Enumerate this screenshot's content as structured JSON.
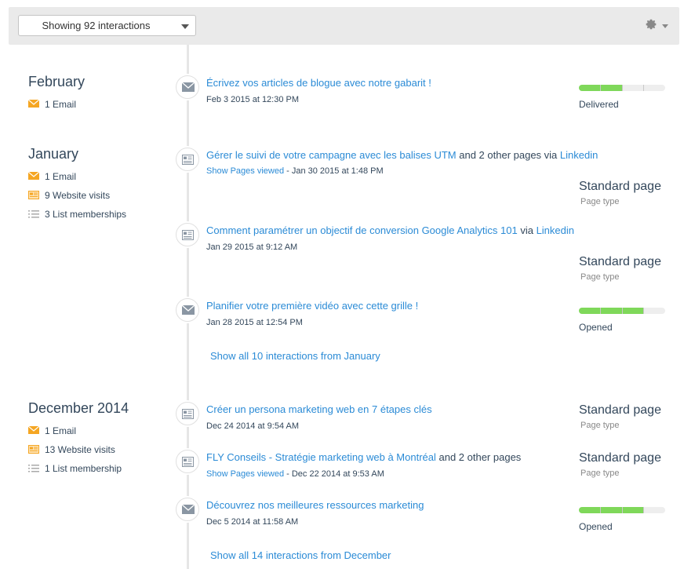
{
  "toolbar": {
    "filter_label": "Showing 92 interactions"
  },
  "months": [
    {
      "name": "February",
      "summary": [
        {
          "icon": "email-icon",
          "text": "1 Email"
        }
      ]
    },
    {
      "name": "January",
      "summary": [
        {
          "icon": "email-icon",
          "text": "1 Email"
        },
        {
          "icon": "website-visit-icon",
          "text": "9 Website visits"
        },
        {
          "icon": "list-icon",
          "text": "3 List memberships"
        }
      ],
      "show_all": "Show all 10 interactions from January"
    },
    {
      "name": "December 2014",
      "summary": [
        {
          "icon": "email-icon",
          "text": "1 Email"
        },
        {
          "icon": "website-visit-icon",
          "text": "13 Website visits"
        },
        {
          "icon": "list-icon",
          "text": "1 List membership"
        }
      ],
      "show_all": "Show all 14 interactions from December"
    }
  ],
  "interactions": [
    {
      "type": "email",
      "title": "Écrivez vos articles de blogue avec notre gabarit !",
      "date": "Feb 3 2015 at 12:30 PM",
      "status": "Delivered",
      "progress": 0.5
    },
    {
      "type": "page",
      "title": "Gérer le suivi de votre campagne avec les balises UTM",
      "extra": " and 2 other pages via ",
      "source": "Linkedin",
      "pages_link": "Show Pages viewed",
      "date": " - Jan 30 2015 at 1:48 PM",
      "meta_title": "Standard page",
      "meta_sub": "Page type"
    },
    {
      "type": "page",
      "title": "Comment paramétrer un objectif de conversion Google Analytics 101",
      "extra": " via ",
      "source": "Linkedin",
      "date": "Jan 29 2015 at 9:12 AM",
      "meta_title": "Standard page",
      "meta_sub": "Page type"
    },
    {
      "type": "email",
      "title": "Planifier votre première vidéo avec cette grille !",
      "date": "Jan 28 2015 at 12:54 PM",
      "status": "Opened",
      "progress": 0.75
    },
    {
      "type": "page",
      "title": "Créer un persona marketing web en 7 étapes clés",
      "date": "Dec 24 2014 at 9:54 AM",
      "meta_title": "Standard page",
      "meta_sub": "Page type"
    },
    {
      "type": "page",
      "title": "FLY Conseils - Stratégie marketing web à Montréal",
      "extra": " and 2 other pages",
      "pages_link": "Show Pages viewed",
      "date": " - Dec 22 2014 at 9:53 AM",
      "meta_title": "Standard page",
      "meta_sub": "Page type"
    },
    {
      "type": "email",
      "title": "Découvrez nos meilleures ressources marketing",
      "date": "Dec 5 2014 at 11:58 AM",
      "status": "Opened",
      "progress": 0.75
    }
  ],
  "colors": {
    "link": "#2b8bd6",
    "email_icon": "#f5a623",
    "progress_fill": "#7fd85a"
  }
}
